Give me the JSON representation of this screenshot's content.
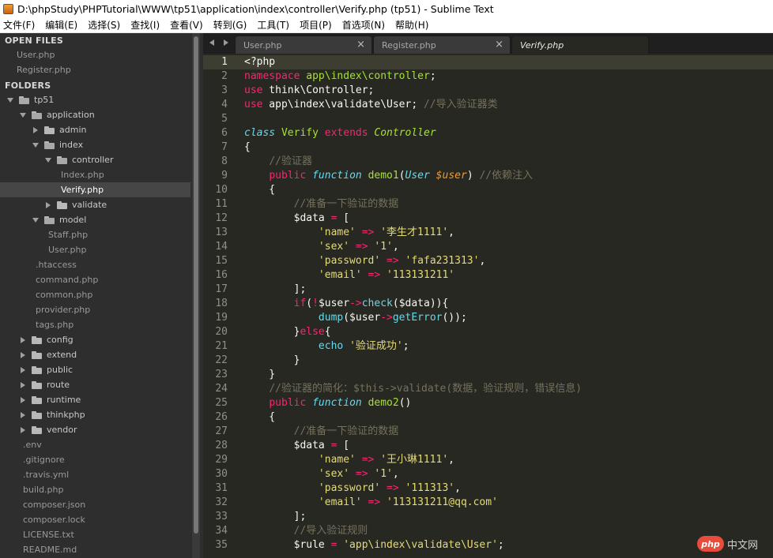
{
  "window": {
    "title": "D:\\phpStudy\\PHPTutorial\\WWW\\tp51\\application\\index\\controller\\Verify.php (tp51) - Sublime Text"
  },
  "menu": [
    "文件(F)",
    "编辑(E)",
    "选择(S)",
    "查找(I)",
    "查看(V)",
    "转到(G)",
    "工具(T)",
    "项目(P)",
    "首选项(N)",
    "帮助(H)"
  ],
  "sidebar": {
    "open_files_label": "OPEN FILES",
    "folders_label": "FOLDERS",
    "open_files": [
      "User.php",
      "Register.php"
    ],
    "tree": [
      {
        "label": "tp51",
        "kind": "folder",
        "open": true,
        "depth": 0
      },
      {
        "label": "application",
        "kind": "folder",
        "open": true,
        "depth": 1
      },
      {
        "label": "admin",
        "kind": "folder",
        "open": false,
        "depth": 2
      },
      {
        "label": "index",
        "kind": "folder",
        "open": true,
        "depth": 2
      },
      {
        "label": "controller",
        "kind": "folder",
        "open": true,
        "depth": 3
      },
      {
        "label": "Index.php",
        "kind": "file",
        "depth": 4
      },
      {
        "label": "Verify.php",
        "kind": "file",
        "depth": 4,
        "selected": true
      },
      {
        "label": "validate",
        "kind": "folder",
        "open": false,
        "depth": 3
      },
      {
        "label": "model",
        "kind": "folder",
        "open": true,
        "depth": 2
      },
      {
        "label": "Staff.php",
        "kind": "file",
        "depth": 3
      },
      {
        "label": "User.php",
        "kind": "file",
        "depth": 3
      },
      {
        "label": ".htaccess",
        "kind": "file",
        "depth": 2
      },
      {
        "label": "command.php",
        "kind": "file",
        "depth": 2
      },
      {
        "label": "common.php",
        "kind": "file",
        "depth": 2
      },
      {
        "label": "provider.php",
        "kind": "file",
        "depth": 2
      },
      {
        "label": "tags.php",
        "kind": "file",
        "depth": 2
      },
      {
        "label": "config",
        "kind": "folder",
        "open": false,
        "depth": 1
      },
      {
        "label": "extend",
        "kind": "folder",
        "open": false,
        "depth": 1
      },
      {
        "label": "public",
        "kind": "folder",
        "open": false,
        "depth": 1
      },
      {
        "label": "route",
        "kind": "folder",
        "open": false,
        "depth": 1
      },
      {
        "label": "runtime",
        "kind": "folder",
        "open": false,
        "depth": 1
      },
      {
        "label": "thinkphp",
        "kind": "folder",
        "open": false,
        "depth": 1
      },
      {
        "label": "vendor",
        "kind": "folder",
        "open": false,
        "depth": 1
      },
      {
        "label": ".env",
        "kind": "file",
        "depth": 1
      },
      {
        "label": ".gitignore",
        "kind": "file",
        "depth": 1
      },
      {
        "label": ".travis.yml",
        "kind": "file",
        "depth": 1
      },
      {
        "label": "build.php",
        "kind": "file",
        "depth": 1
      },
      {
        "label": "composer.json",
        "kind": "file",
        "depth": 1
      },
      {
        "label": "composer.lock",
        "kind": "file",
        "depth": 1
      },
      {
        "label": "LICENSE.txt",
        "kind": "file",
        "depth": 1
      },
      {
        "label": "README.md",
        "kind": "file",
        "depth": 1
      }
    ]
  },
  "tabs": [
    {
      "label": "User.php",
      "active": false
    },
    {
      "label": "Register.php",
      "active": false
    },
    {
      "label": "Verify.php",
      "active": true
    }
  ],
  "editor": {
    "current_line": 1,
    "lines": [
      [
        [
          "tx",
          "<?php"
        ]
      ],
      [
        [
          "kw",
          "namespace"
        ],
        [
          "tx",
          " "
        ],
        [
          "fn",
          "app\\index\\controller"
        ],
        [
          "tx",
          ";"
        ]
      ],
      [
        [
          "kw",
          "use"
        ],
        [
          "tx",
          " think\\Controller;"
        ]
      ],
      [
        [
          "kw",
          "use"
        ],
        [
          "tx",
          " app\\index\\validate\\User; "
        ],
        [
          "cm",
          "//导入验证器类"
        ]
      ],
      [],
      [
        [
          "ty",
          "class"
        ],
        [
          "tx",
          " "
        ],
        [
          "fn",
          "Verify"
        ],
        [
          "tx",
          " "
        ],
        [
          "kw",
          "extends"
        ],
        [
          "tx",
          " "
        ],
        [
          "it",
          "Controller"
        ]
      ],
      [
        [
          "tx",
          "{"
        ]
      ],
      [
        [
          "tx",
          "    "
        ],
        [
          "cm",
          "//验证器"
        ]
      ],
      [
        [
          "tx",
          "    "
        ],
        [
          "kw",
          "public"
        ],
        [
          "tx",
          " "
        ],
        [
          "ty",
          "function"
        ],
        [
          "tx",
          " "
        ],
        [
          "fn",
          "demo1"
        ],
        [
          "tx",
          "("
        ],
        [
          "ty",
          "User"
        ],
        [
          "tx",
          " "
        ],
        [
          "pa",
          "$user"
        ],
        [
          "tx",
          ") "
        ],
        [
          "cm",
          "//依赖注入"
        ]
      ],
      [
        [
          "tx",
          "    {"
        ]
      ],
      [
        [
          "tx",
          "        "
        ],
        [
          "cm",
          "//准备一下验证的数据"
        ]
      ],
      [
        [
          "tx",
          "        $data "
        ],
        [
          "op",
          "="
        ],
        [
          "tx",
          " ["
        ]
      ],
      [
        [
          "tx",
          "            "
        ],
        [
          "st",
          "'name'"
        ],
        [
          "tx",
          " "
        ],
        [
          "op",
          "=>"
        ],
        [
          "tx",
          " "
        ],
        [
          "st",
          "'李生才1111'"
        ],
        [
          "tx",
          ","
        ]
      ],
      [
        [
          "tx",
          "            "
        ],
        [
          "st",
          "'sex'"
        ],
        [
          "tx",
          " "
        ],
        [
          "op",
          "=>"
        ],
        [
          "tx",
          " "
        ],
        [
          "st",
          "'1'"
        ],
        [
          "tx",
          ","
        ]
      ],
      [
        [
          "tx",
          "            "
        ],
        [
          "st",
          "'password'"
        ],
        [
          "tx",
          " "
        ],
        [
          "op",
          "=>"
        ],
        [
          "tx",
          " "
        ],
        [
          "st",
          "'fafa231313'"
        ],
        [
          "tx",
          ","
        ]
      ],
      [
        [
          "tx",
          "            "
        ],
        [
          "st",
          "'email'"
        ],
        [
          "tx",
          " "
        ],
        [
          "op",
          "=>"
        ],
        [
          "tx",
          " "
        ],
        [
          "st",
          "'113131211'"
        ]
      ],
      [
        [
          "tx",
          "        ];"
        ]
      ],
      [
        [
          "tx",
          "        "
        ],
        [
          "kw",
          "if"
        ],
        [
          "tx",
          "("
        ],
        [
          "op",
          "!"
        ],
        [
          "tx",
          "$user"
        ],
        [
          "op",
          "->"
        ],
        [
          "bi",
          "check"
        ],
        [
          "tx",
          "($data)){"
        ]
      ],
      [
        [
          "tx",
          "            "
        ],
        [
          "bi",
          "dump"
        ],
        [
          "tx",
          "($user"
        ],
        [
          "op",
          "->"
        ],
        [
          "bi",
          "getError"
        ],
        [
          "tx",
          "());"
        ]
      ],
      [
        [
          "tx",
          "        }"
        ],
        [
          "kw",
          "else"
        ],
        [
          "tx",
          "{"
        ]
      ],
      [
        [
          "tx",
          "            "
        ],
        [
          "bi",
          "echo"
        ],
        [
          "tx",
          " "
        ],
        [
          "st",
          "'验证成功'"
        ],
        [
          "tx",
          ";"
        ]
      ],
      [
        [
          "tx",
          "        }"
        ]
      ],
      [
        [
          "tx",
          "    }"
        ]
      ],
      [
        [
          "tx",
          "    "
        ],
        [
          "cm",
          "//验证器的简化：$this->validate(数据，验证规则，错误信息)"
        ]
      ],
      [
        [
          "tx",
          "    "
        ],
        [
          "kw",
          "public"
        ],
        [
          "tx",
          " "
        ],
        [
          "ty",
          "function"
        ],
        [
          "tx",
          " "
        ],
        [
          "fn",
          "demo2"
        ],
        [
          "tx",
          "()"
        ]
      ],
      [
        [
          "tx",
          "    {"
        ]
      ],
      [
        [
          "tx",
          "        "
        ],
        [
          "cm",
          "//准备一下验证的数据"
        ]
      ],
      [
        [
          "tx",
          "        $data "
        ],
        [
          "op",
          "="
        ],
        [
          "tx",
          " ["
        ]
      ],
      [
        [
          "tx",
          "            "
        ],
        [
          "st",
          "'name'"
        ],
        [
          "tx",
          " "
        ],
        [
          "op",
          "=>"
        ],
        [
          "tx",
          " "
        ],
        [
          "st",
          "'王小琳1111'"
        ],
        [
          "tx",
          ","
        ]
      ],
      [
        [
          "tx",
          "            "
        ],
        [
          "st",
          "'sex'"
        ],
        [
          "tx",
          " "
        ],
        [
          "op",
          "=>"
        ],
        [
          "tx",
          " "
        ],
        [
          "st",
          "'1'"
        ],
        [
          "tx",
          ","
        ]
      ],
      [
        [
          "tx",
          "            "
        ],
        [
          "st",
          "'password'"
        ],
        [
          "tx",
          " "
        ],
        [
          "op",
          "=>"
        ],
        [
          "tx",
          " "
        ],
        [
          "st",
          "'111313'"
        ],
        [
          "tx",
          ","
        ]
      ],
      [
        [
          "tx",
          "            "
        ],
        [
          "st",
          "'email'"
        ],
        [
          "tx",
          " "
        ],
        [
          "op",
          "=>"
        ],
        [
          "tx",
          " "
        ],
        [
          "st",
          "'113131211@qq.com'"
        ]
      ],
      [
        [
          "tx",
          "        ];"
        ]
      ],
      [
        [
          "tx",
          "        "
        ],
        [
          "cm",
          "//导入验证规则"
        ]
      ],
      [
        [
          "tx",
          "        $rule "
        ],
        [
          "op",
          "="
        ],
        [
          "tx",
          " "
        ],
        [
          "st",
          "'app\\index\\validate\\User'"
        ],
        [
          "tx",
          ";"
        ]
      ]
    ]
  },
  "watermark": {
    "logo": "php",
    "text": "中文网"
  }
}
